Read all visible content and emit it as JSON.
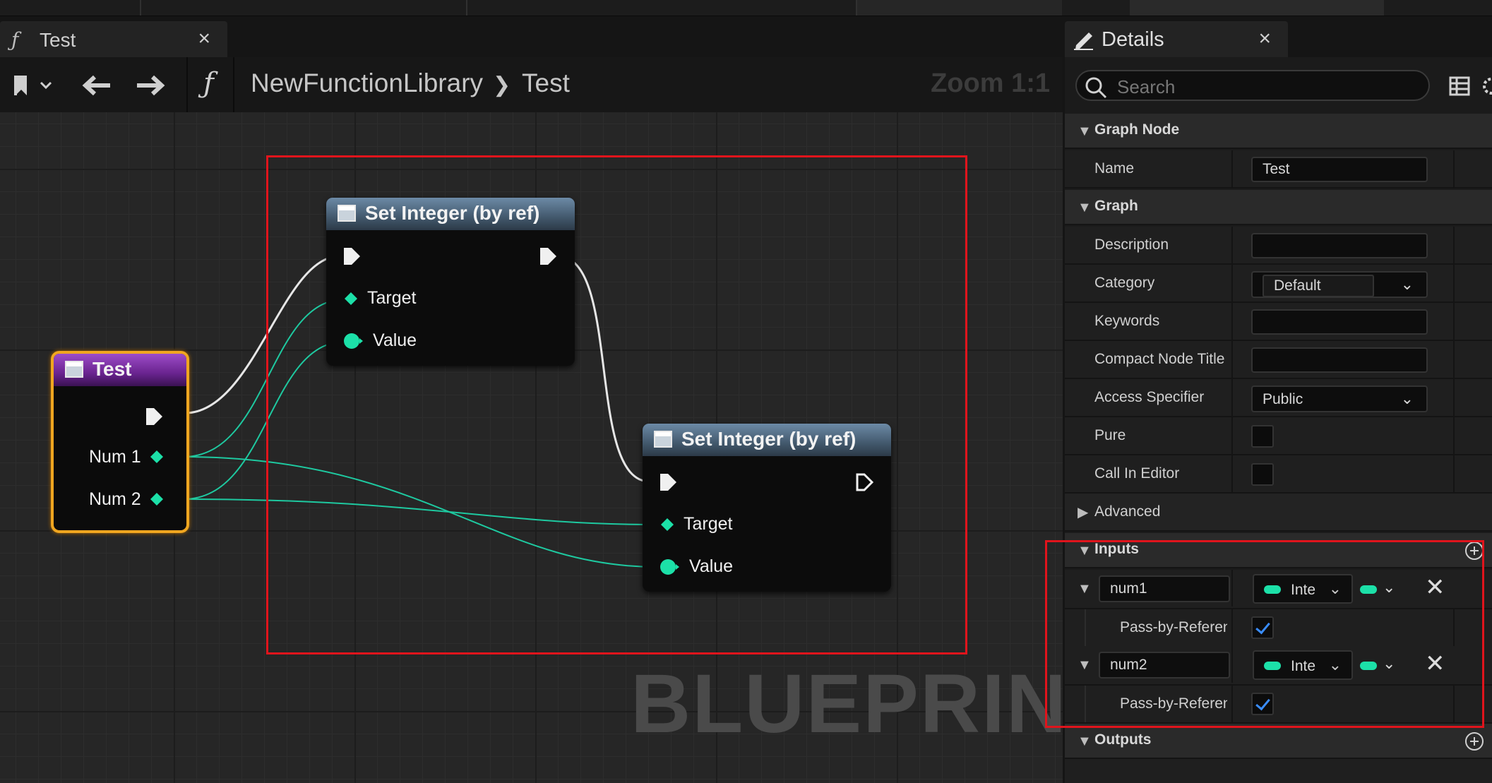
{
  "graph_tab": {
    "fn_glyph": "ƒ",
    "title": "Test",
    "close": "×"
  },
  "toolbar": {
    "fn_glyph": "ƒ",
    "breadcrumb": [
      "NewFunctionLibrary",
      "Test"
    ],
    "separator": "❯",
    "zoom": "Zoom 1:1"
  },
  "watermark": "BLUEPRINT",
  "nodes": {
    "entry": {
      "title": "Test",
      "pins": [
        "Num 1",
        "Num 2"
      ]
    },
    "set1": {
      "title": "Set Integer (by ref)",
      "pins": [
        "Target",
        "Value"
      ]
    },
    "set2": {
      "title": "Set Integer (by ref)",
      "pins": [
        "Target",
        "Value"
      ]
    }
  },
  "details": {
    "tab_title": "Details",
    "close": "×",
    "search_placeholder": "Search",
    "sections": {
      "graph_node": "Graph Node",
      "graph": "Graph",
      "advanced": "Advanced",
      "inputs": "Inputs",
      "outputs": "Outputs"
    },
    "graph_node": {
      "name_label": "Name",
      "name_value": "Test"
    },
    "graph": {
      "description_label": "Description",
      "description_value": "",
      "category_label": "Category",
      "category_value": "Default",
      "keywords_label": "Keywords",
      "keywords_value": "",
      "compact_title_label": "Compact Node Title",
      "compact_title_value": "",
      "access_label": "Access Specifier",
      "access_value": "Public",
      "pure_label": "Pure",
      "pure_checked": false,
      "call_in_editor_label": "Call In Editor",
      "call_in_editor_checked": false
    },
    "inputs": [
      {
        "name": "num1",
        "type": "Integer",
        "type_short": "Inte",
        "pbr_label": "Pass-by-Referen",
        "pbr_checked": true
      },
      {
        "name": "num2",
        "type": "Integer",
        "type_short": "Inte",
        "pbr_label": "Pass-by-Referen",
        "pbr_checked": true
      }
    ]
  },
  "colors": {
    "integer_pin": "#1ce0a8",
    "selection": "#e0141c",
    "entry_node_border": "#f0a620",
    "entry_node_header": "#7a2ea6",
    "set_node_header": "#56708a"
  }
}
